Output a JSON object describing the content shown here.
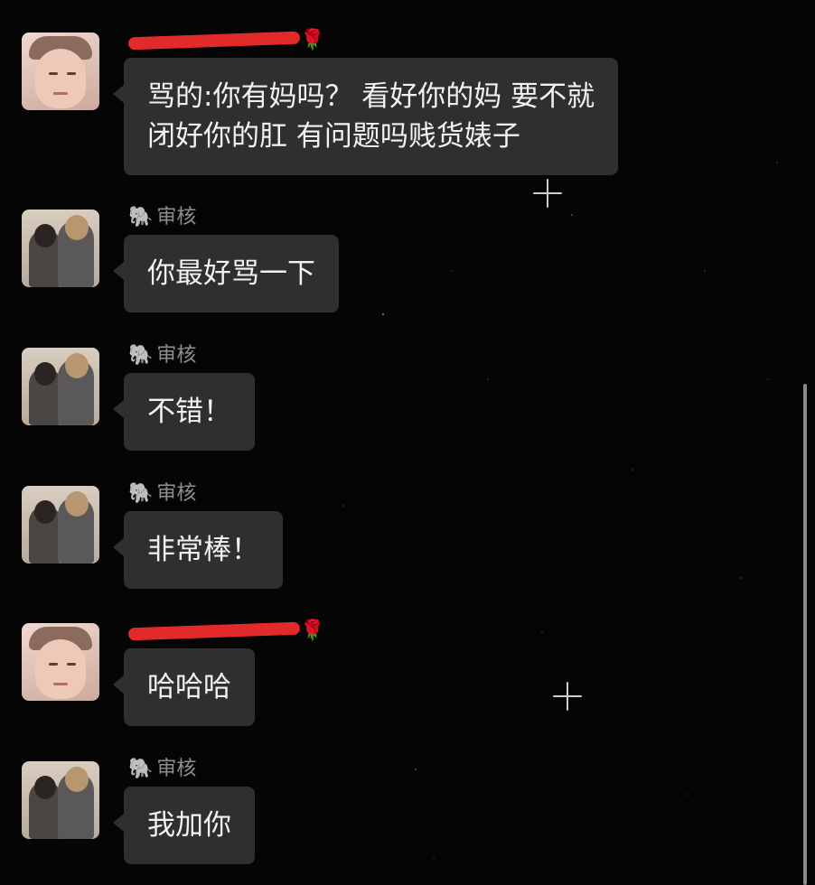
{
  "messages": [
    {
      "sender": "",
      "sender_icon": "🌹",
      "avatar": "male",
      "lines": [
        "骂的:你有妈吗？ 看好你的妈 要不就",
        "闭好你的肛 有问题吗贱货婊子"
      ]
    },
    {
      "sender": "审核",
      "sender_icon": "🐘",
      "avatar": "couple",
      "lines": [
        "你最好骂一下"
      ]
    },
    {
      "sender": "审核",
      "sender_icon": "🐘",
      "avatar": "couple",
      "lines": [
        "不错！"
      ]
    },
    {
      "sender": "审核",
      "sender_icon": "🐘",
      "avatar": "couple",
      "lines": [
        "非常棒！"
      ]
    },
    {
      "sender": "",
      "sender_icon": "🌹",
      "avatar": "male",
      "lines": [
        "哈哈哈"
      ]
    },
    {
      "sender": "审核",
      "sender_icon": "🐘",
      "avatar": "couple",
      "lines": [
        "我加你"
      ]
    }
  ],
  "icons": {
    "redacted_sender": "rose-icon",
    "review_sender": "elephant-icon"
  },
  "colors": {
    "background": "#050505",
    "bubble": "#2f2f2f",
    "redaction": "#e32a2a"
  }
}
